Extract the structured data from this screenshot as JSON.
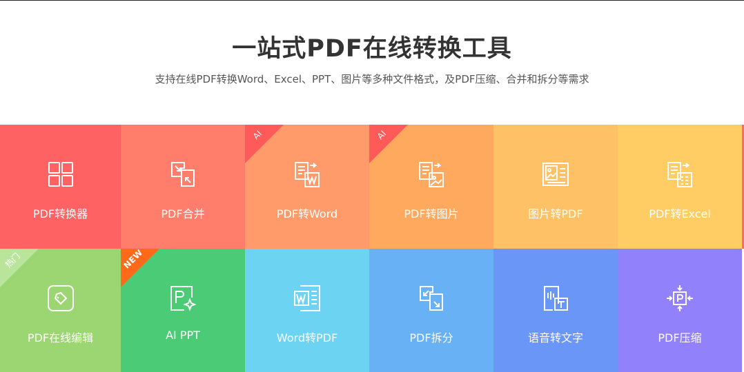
{
  "hero": {
    "title": "一站式PDF在线转换工具",
    "subtitle": "支持在线PDF转换Word、Excel、PPT、图片等多种文件格式，及PDF压缩、合并和拆分等需求"
  },
  "tools": [
    {
      "label": "PDF转换器",
      "color": "#ff6262",
      "icon": "grid-icon"
    },
    {
      "label": "PDF合并",
      "color": "#ff7e6b",
      "icon": "merge-icon"
    },
    {
      "label": "PDF转Word",
      "color": "#ff9a6a",
      "icon": "pdf-to-word-icon",
      "badge": "AI",
      "badge_color": "#ff5a5a"
    },
    {
      "label": "PDF转图片",
      "color": "#ffa95f",
      "icon": "pdf-to-image-icon",
      "badge": "AI",
      "badge_color": "#ff5a5a"
    },
    {
      "label": "图片转PDF",
      "color": "#ffc165",
      "icon": "image-to-pdf-icon"
    },
    {
      "label": "PDF转Excel",
      "color": "#ffcd63",
      "icon": "pdf-to-excel-icon"
    },
    {
      "label": "PDF在线编辑",
      "color": "#9bd672",
      "icon": "edit-icon",
      "badge": "热门",
      "badge_color": "#b9e59a"
    },
    {
      "label": "AI PPT",
      "color": "#4bcb76",
      "icon": "ai-ppt-icon",
      "badge": "NEW",
      "badge_color": "#ff6a1a"
    },
    {
      "label": "Word转PDF",
      "color": "#6dd3f2",
      "icon": "word-to-pdf-icon"
    },
    {
      "label": "PDF拆分",
      "color": "#69b1f5",
      "icon": "split-icon"
    },
    {
      "label": "语音转文字",
      "color": "#6a96f8",
      "icon": "speech-to-text-icon"
    },
    {
      "label": "PDF压缩",
      "color": "#9181fb",
      "icon": "compress-icon"
    }
  ]
}
